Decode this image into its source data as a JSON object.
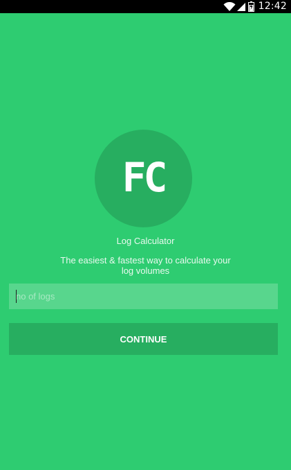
{
  "status_bar": {
    "time": "12:42",
    "icons": [
      "wifi-icon",
      "signal-icon",
      "battery-icon"
    ]
  },
  "logo": {
    "text": "FC"
  },
  "app": {
    "name": "Log Calculator",
    "tagline": "The easiest & fastest way to calculate your log volumes"
  },
  "input": {
    "value": "",
    "placeholder": "no of logs"
  },
  "continue_button": {
    "label": "CONTINUE"
  },
  "colors": {
    "background": "#2ecc71",
    "accent_dark": "#27ae60",
    "input_background": "#58d68d",
    "status_bar": "#000000"
  }
}
